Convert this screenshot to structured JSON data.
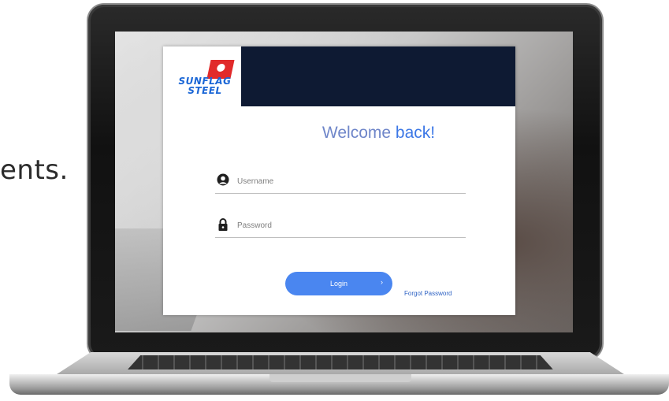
{
  "slide": {
    "partial_text": "ents."
  },
  "login": {
    "brand_line1": "SUNFLAG",
    "brand_line2": "STEEL",
    "welcome_prefix": "Welcome",
    "welcome_accent": "back!",
    "username_placeholder": "Username",
    "password_placeholder": "Password",
    "login_label": "Login",
    "forgot_label": "Forgot Password"
  },
  "colors": {
    "header_bar": "#0e1a33",
    "primary_button": "#4a86f0",
    "brand_red": "#e12a2a",
    "brand_blue": "#1a66d6"
  },
  "icons": {
    "username": "user-icon",
    "password": "lock-icon",
    "login_chevron": "chevron-right-icon"
  }
}
